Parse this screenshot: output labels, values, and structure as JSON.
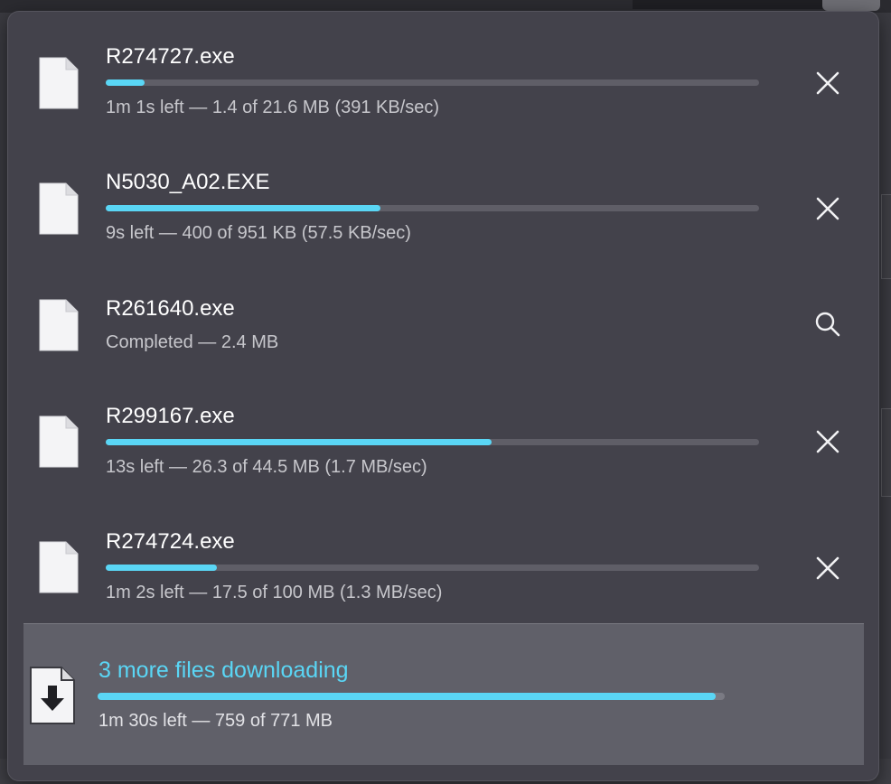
{
  "colors": {
    "accent": "#5ad6f5",
    "panel": "#43424b",
    "summary_bg": "#606069"
  },
  "downloads": [
    {
      "name": "R274727.exe",
      "status": "1m 1s left — 1.4 of 21.6 MB (391 KB/sec)",
      "progress": 0.06,
      "action_icon": "close-icon"
    },
    {
      "name": "N5030_A02.EXE",
      "status": "9s left — 400 of 951 KB (57.5 KB/sec)",
      "progress": 0.42,
      "action_icon": "close-icon"
    },
    {
      "name": "R261640.exe",
      "status": "Completed — 2.4 MB",
      "progress": 1.0,
      "action_icon": "search-icon"
    },
    {
      "name": "R299167.exe",
      "status": "13s left — 26.3 of 44.5 MB (1.7 MB/sec)",
      "progress": 0.59,
      "action_icon": "close-icon"
    },
    {
      "name": "R274724.exe",
      "status": "1m 2s left — 17.5 of 100 MB (1.3 MB/sec)",
      "progress": 0.17,
      "action_icon": "close-icon"
    }
  ],
  "summary": {
    "title": "3 more files downloading",
    "status": "1m 30s left — 759 of 771 MB",
    "progress": 0.985,
    "icon": "download-arrow-icon"
  }
}
